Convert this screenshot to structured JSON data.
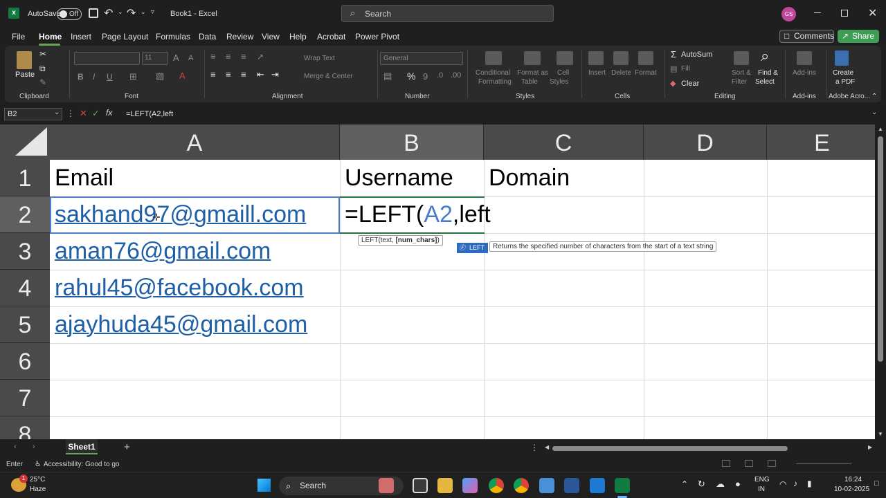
{
  "app": {
    "autosave_label": "AutoSave",
    "autosave_state": "Off",
    "title": "Book1  -  Excel",
    "search_placeholder": "Search",
    "avatar_initials": "GS"
  },
  "menu": {
    "items": [
      "File",
      "Home",
      "Insert",
      "Page Layout",
      "Formulas",
      "Data",
      "Review",
      "View",
      "Help",
      "Acrobat",
      "Power Pivot"
    ],
    "comments_label": "Comments",
    "share_label": "Share"
  },
  "ribbon": {
    "clipboard": {
      "paste": "Paste",
      "label": "Clipboard"
    },
    "font": {
      "label": "Font",
      "size_value": "11",
      "bold": "B",
      "italic": "I",
      "underline": "U",
      "inc": "A",
      "dec": "A"
    },
    "alignment": {
      "label": "Alignment",
      "wrap": "Wrap Text",
      "merge": "Merge & Center"
    },
    "number": {
      "label": "Number",
      "format": "General",
      "percent": "%",
      "comma": "9"
    },
    "styles": {
      "label": "Styles",
      "conditional": "Conditional",
      "conditional2": "Formatting",
      "format_as": "Format as",
      "format_as2": "Table",
      "cell_styles": "Cell",
      "cell_styles2": "Styles"
    },
    "cells": {
      "label": "Cells",
      "insert": "Insert",
      "delete": "Delete",
      "format": "Format"
    },
    "editing": {
      "label": "Editing",
      "autosum": "AutoSum",
      "fill": "Fill",
      "clear": "Clear",
      "sort": "Sort &",
      "sort2": "Filter",
      "find": "Find &",
      "find2": "Select"
    },
    "addins": {
      "label": "Add-ins",
      "btn": "Add-ins"
    },
    "acrobat": {
      "label": "Adobe Acro...",
      "create": "Create",
      "create2": "a PDF"
    }
  },
  "formula_bar": {
    "name_box": "B2",
    "fx": "fx",
    "content": "=LEFT(A2,left"
  },
  "grid": {
    "columns": [
      "A",
      "B",
      "C",
      "D",
      "E"
    ],
    "rows": [
      "1",
      "2",
      "3",
      "4",
      "5",
      "6",
      "7",
      "8"
    ],
    "cells": {
      "A1": "Email",
      "B1": "Username",
      "C1": "Domain",
      "A2": "sakhand97@gmaill.com",
      "A3": "aman76@gmail.com",
      "A4": "rahul45@facebook.com",
      "A5": "ajayhuda45@gmail.com",
      "B2_prefix": "=LEFT(",
      "B2_ref": "A2",
      "B2_suffix": ",left"
    },
    "tooltip_syntax": "LEFT(text, ",
    "tooltip_syntax_bold": "[num_chars]",
    "tooltip_syntax_end": ")",
    "tooltip_fn": "LEFT",
    "tooltip_desc": "Returns the specified number of characters from the start of a text string"
  },
  "sheets": {
    "tabs": [
      "Sheet1"
    ],
    "add": "+"
  },
  "status": {
    "mode": "Enter",
    "accessibility": "Accessibility: Good to go"
  },
  "taskbar": {
    "weather_temp": "25°C",
    "weather_desc": "Haze",
    "weather_badge": "1",
    "search": "Search",
    "lang1": "ENG",
    "lang2": "IN",
    "time": "16:24",
    "date": "10-02-2025"
  },
  "colors": {
    "accent_green": "#3f9c55",
    "link_blue": "#1f5fa6",
    "excel_green": "#107c41"
  }
}
